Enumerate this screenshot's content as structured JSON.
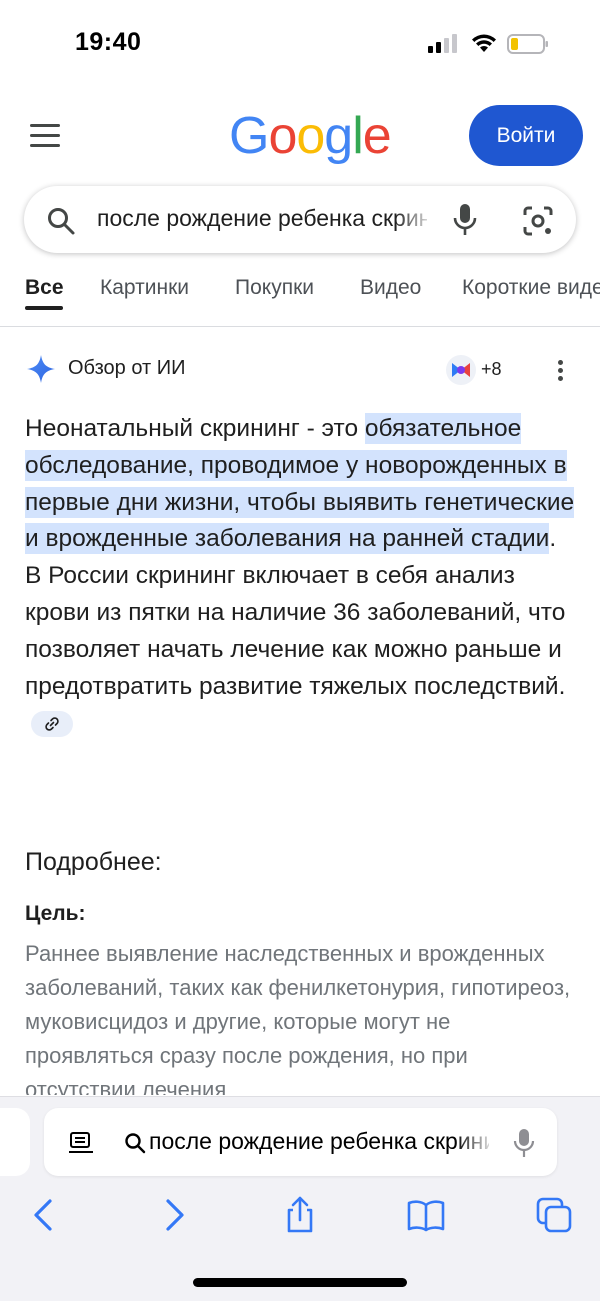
{
  "status_bar": {
    "time": "19:40"
  },
  "header": {
    "logo_letters": [
      {
        "char": "G",
        "color": "#4285F4"
      },
      {
        "char": "o",
        "color": "#EA4335"
      },
      {
        "char": "o",
        "color": "#FBBC05"
      },
      {
        "char": "g",
        "color": "#4285F4"
      },
      {
        "char": "l",
        "color": "#34A853"
      },
      {
        "char": "e",
        "color": "#EA4335"
      }
    ],
    "signin_label": "Войти",
    "signin_color": "#1f57d1"
  },
  "search": {
    "query": "после рождение ребенка скрининг"
  },
  "tabs": [
    {
      "label": "Все",
      "active": true
    },
    {
      "label": "Картинки",
      "active": false
    },
    {
      "label": "Покупки",
      "active": false
    },
    {
      "label": "Видео",
      "active": false
    },
    {
      "label": "Короткие видео",
      "active": false
    }
  ],
  "ai_overview": {
    "title": "Обзор от ИИ",
    "sources_count": "+8",
    "answer_intro": "Неонатальный скрининг - это ",
    "answer_highlight": "обязательное обследование, проводимое у новорожденных в первые дни жизни, чтобы выявить генетические и врожденные заболевания на ранней стадии",
    "answer_rest": ". В России скрининг включает в себя анализ крови из пятки на наличие 36 заболеваний, что позволяет начать лечение как можно раньше и предотвратить развитие тяжелых последствий.",
    "highlight_color": "#d3e3fd",
    "more_heading": "Подробнее:",
    "goal_label": "Цель:",
    "goal_text": "Раннее выявление наследственных и врожденных заболеваний, таких как фенилкетонурия, гипотиреоз, муковисцидоз и другие, которые могут не проявляться сразу после рождения, но при отсутствии лечения"
  },
  "browser": {
    "address_text": "после рождение ребенка скрининг",
    "icons": [
      "reader-icon",
      "search-icon",
      "mic-icon",
      "back-icon",
      "forward-icon",
      "share-icon",
      "bookmarks-icon",
      "tabs-icon"
    ],
    "accent": "#3478f6"
  }
}
